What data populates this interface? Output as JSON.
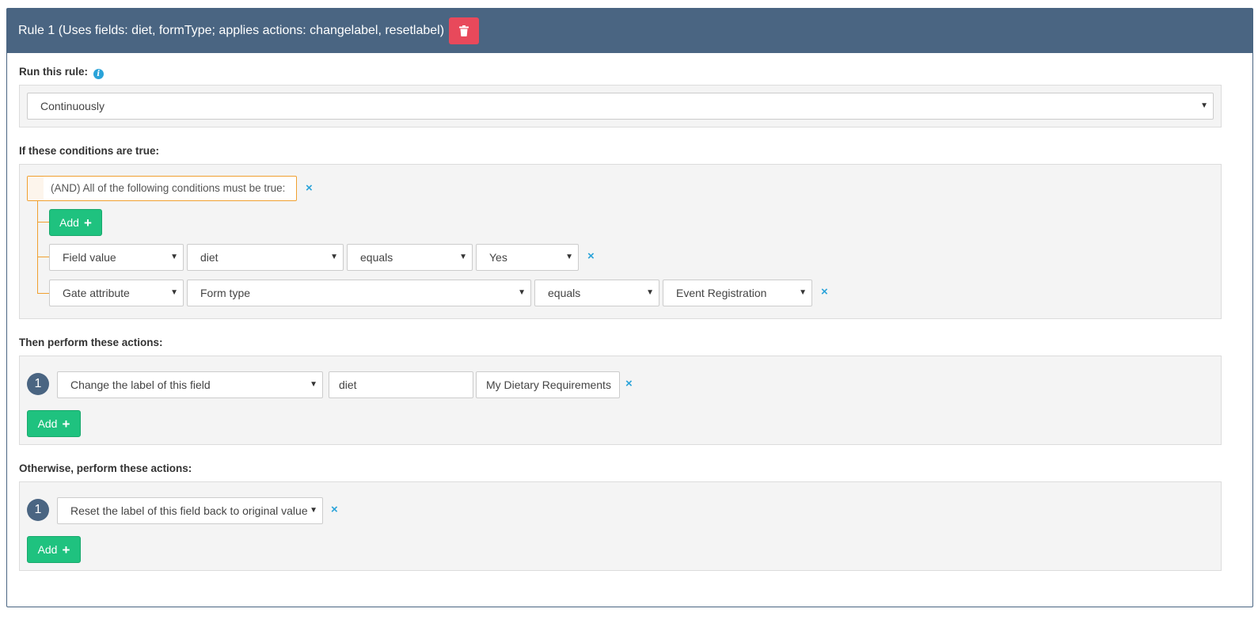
{
  "rule": {
    "title": "Rule 1 (Uses fields: diet, formType; applies actions: changelabel, resetlabel)"
  },
  "run": {
    "label": "Run this rule:",
    "info_glyph": "i",
    "selected": "Continuously"
  },
  "conditions": {
    "label": "If these conditions are true:",
    "group_text": "(AND) All of the following conditions must be true:",
    "add_label": "Add",
    "rows": [
      {
        "type": "Field value",
        "field": "diet",
        "operator": "equals",
        "value": "Yes"
      },
      {
        "type": "Gate attribute",
        "field": "Form type",
        "operator": "equals",
        "value": "Event Registration"
      }
    ]
  },
  "actions": {
    "label": "Then perform these actions:",
    "add_label": "Add",
    "items": [
      {
        "number": "1",
        "action": "Change the label of this field",
        "field": "diet",
        "value": "My Dietary Requirements"
      }
    ]
  },
  "otherwise": {
    "label": "Otherwise, perform these actions:",
    "add_label": "Add",
    "items": [
      {
        "number": "1",
        "action": "Reset the label of this field back to original value"
      }
    ]
  },
  "glyphs": {
    "caret": "▼",
    "remove": "×",
    "plus": "+"
  },
  "colors": {
    "header_bg": "#4a6582",
    "delete_btn": "#e8495b",
    "add_btn": "#1fc27f",
    "remove_x": "#2aa3d9",
    "and_border": "#f0a030"
  },
  "icons": {
    "delete": "trash-icon",
    "info": "info-icon"
  }
}
